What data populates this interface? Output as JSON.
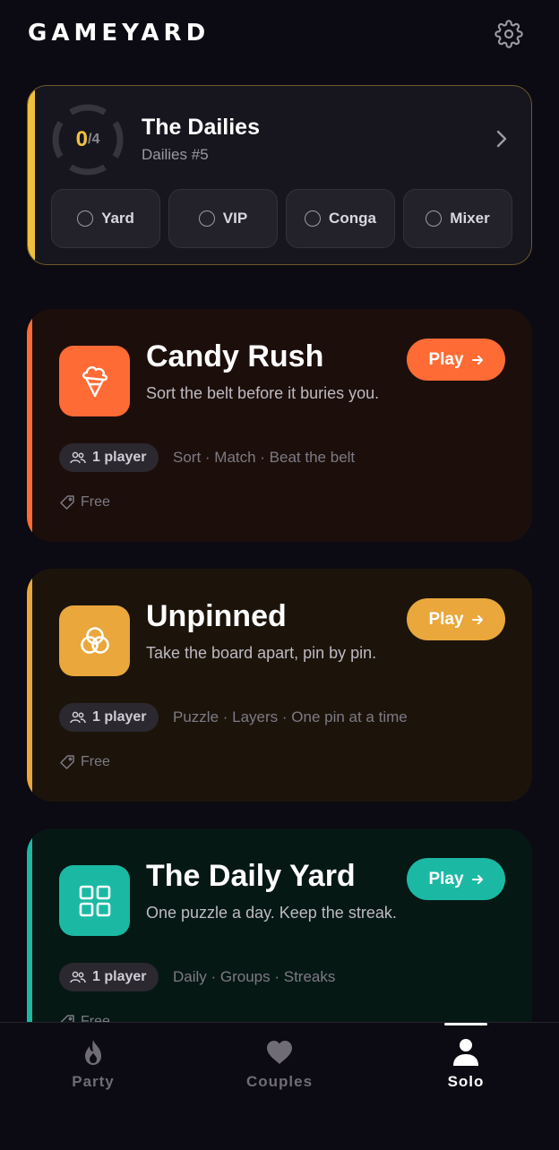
{
  "header": {
    "brand": "GAMEYARD"
  },
  "dailies": {
    "completed": "0",
    "total": "/4",
    "progress": 0,
    "title": "The Dailies",
    "subtitle": "Dailies #5",
    "accent_color": "#f0c23c",
    "chips": [
      {
        "label": "Yard"
      },
      {
        "label": "VIP"
      },
      {
        "label": "Conga"
      },
      {
        "label": "Mixer"
      }
    ]
  },
  "games": [
    {
      "title": "Candy Rush",
      "description": "Sort the belt before it buries you.",
      "play_label": "Play",
      "players": "1 player",
      "tags": "Sort · Match · Beat the belt",
      "price": "Free",
      "icon": "ice-cream-icon",
      "accent_color": "#ff6b35",
      "bg_color": "#1c0f0b"
    },
    {
      "title": "Unpinned",
      "description": "Take the board apart, pin by pin.",
      "play_label": "Play",
      "players": "1 player",
      "tags": "Puzzle · Layers · One pin at a time",
      "price": "Free",
      "icon": "circles-icon",
      "accent_color": "#e9a73c",
      "bg_color": "#1c140b"
    },
    {
      "title": "The Daily Yard",
      "description": "One puzzle a day. Keep the streak.",
      "play_label": "Play",
      "players": "1 player",
      "tags": "Daily · Groups · Streaks",
      "price": "Free",
      "icon": "grid-icon",
      "accent_color": "#1bb9a4",
      "bg_color": "#061814"
    }
  ],
  "nav": {
    "items": [
      {
        "label": "Party",
        "icon": "flame-icon"
      },
      {
        "label": "Couples",
        "icon": "heart-icon"
      },
      {
        "label": "Solo",
        "icon": "person-icon",
        "active": true
      }
    ]
  }
}
